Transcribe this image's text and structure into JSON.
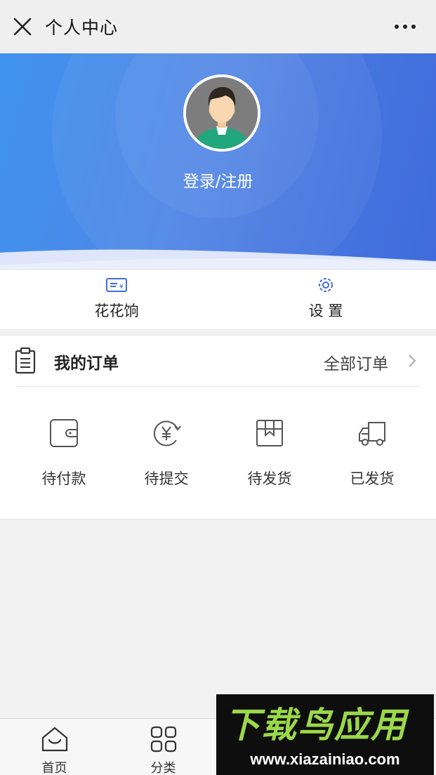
{
  "header": {
    "title": "个人中心",
    "close_icon": "close-icon",
    "more_icon": "more-icon"
  },
  "profile": {
    "avatar_icon": "avatar",
    "login_label": "登录/注册"
  },
  "quick_actions": [
    {
      "label": "花花饷",
      "icon": "ticket-icon"
    },
    {
      "label": "设 置",
      "icon": "gear-icon"
    }
  ],
  "orders": {
    "title": "我的订单",
    "all_orders_label": "全部订单",
    "statuses": [
      {
        "label": "待付款",
        "icon": "wallet-icon"
      },
      {
        "label": "待提交",
        "icon": "yen-refresh-icon"
      },
      {
        "label": "待发货",
        "icon": "package-icon"
      },
      {
        "label": "已发货",
        "icon": "truck-icon"
      }
    ]
  },
  "tabbar": {
    "tabs": [
      {
        "label": "首页",
        "icon": "home-icon"
      },
      {
        "label": "分类",
        "icon": "grid-icon"
      }
    ]
  },
  "watermark": {
    "brand": "下载鸟应用",
    "url": "www.xiazainiao.com"
  },
  "colors": {
    "hero_start": "#3f93ee",
    "hero_end": "#3f6bdc",
    "brand_green": "#9bd84a"
  }
}
